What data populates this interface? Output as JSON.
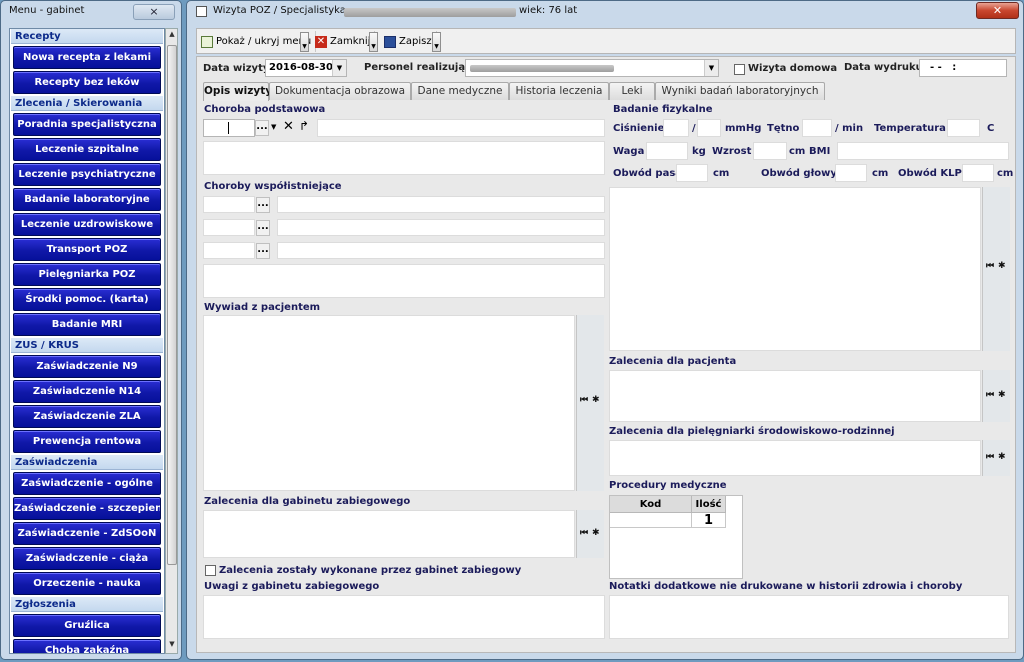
{
  "menu": {
    "title": "Menu - gabinet",
    "close": "×",
    "sections": [
      {
        "header": "Recepty",
        "items": [
          "Nowa recepta z lekami",
          "Recepty  bez leków"
        ]
      },
      {
        "header": "Zlecenia / Skierowania",
        "items": [
          "Poradnia specjalistyczna",
          "Leczenie szpitalne",
          "Leczenie psychiatryczne",
          "Badanie laboratoryjne",
          "Leczenie uzdrowiskowe",
          "Transport POZ",
          "Pielęgniarka POZ",
          "Środki pomoc. (karta)",
          "Badanie MRI"
        ]
      },
      {
        "header": "ZUS / KRUS",
        "items": [
          "Zaświadczenie N9",
          "Zaświadczenie N14",
          "Zaświadczenie ZLA",
          "Prewencja rentowa"
        ]
      },
      {
        "header": "Zaświadczenia",
        "items": [
          "Zaświadczenie - ogólne",
          "Zaświadczenie - szczepienie",
          "Zaświadczenie - ZdSOoN",
          "Zaświadczenie  - ciąża",
          "Orzeczenie - nauka"
        ]
      },
      {
        "header": "Zgłoszenia",
        "items": [
          "Gruźlica",
          "Choba zakaźna"
        ]
      }
    ]
  },
  "main": {
    "title_prefix": "Wizyta POZ / Specjalistyka -",
    "title_suffix": "wiek: 76 lat",
    "close": "✕",
    "toolbar": {
      "show_menu": "Pokaż / ukryj menu",
      "close": "Zamknij",
      "save": "Zapisz"
    },
    "header": {
      "date_label": "Data wizyty",
      "date_value": "2016-08-30",
      "staff_label": "Personel realizujący",
      "home_visit_label": "Wizyta domowa",
      "print_date_label": "Data wydruku",
      "print_date_value": "- -   :"
    },
    "tabs": [
      "Opis wizyty",
      "Dokumentacja obrazowa",
      "Dane medyczne",
      "Historia leczenia",
      "Leki",
      "Wyniki badań laboratoryjnych"
    ],
    "left": {
      "main_disease": "Choroba podstawowa",
      "dots": "...",
      "coexisting": "Choroby współistniejące",
      "interview": "Wywiad z pacjentem",
      "treatment_orders": "Zalecenia dla gabinetu zabiegowego",
      "done_check": "Zalecenia zostały wykonane przez gabinet zabiegowy",
      "treatment_notes": "Uwagi z gabinetu zabiegowego"
    },
    "right": {
      "physical": "Badanie fizykalne",
      "pressure": "Ciśnienie",
      "slash": "/",
      "mmhg": "mmHg",
      "pulse": "Tętno",
      "per_min": "/ min",
      "temperature": "Temperatura",
      "celsius": "C",
      "weight": "Waga",
      "kg": "kg",
      "height": "Wzrost",
      "cm": "cm",
      "bmi": "BMI",
      "waist": "Obwód pasa",
      "head": "Obwód głowy",
      "klp": "Obwód KLP",
      "patient_orders": "Zalecenia dla pacjenta",
      "nurse_orders": "Zalecenia dla pielęgniarki środowiskowo-rodzinnej",
      "procedures": "Procedury medyczne",
      "proc_code": "Kod",
      "proc_qty": "Ilość",
      "proc_qty_value": "1",
      "extra_notes": "Notatki dodatkowe nie drukowane w historii zdrowia i choroby"
    },
    "side_icons": {
      "first": "⏮",
      "star": "✱"
    }
  }
}
